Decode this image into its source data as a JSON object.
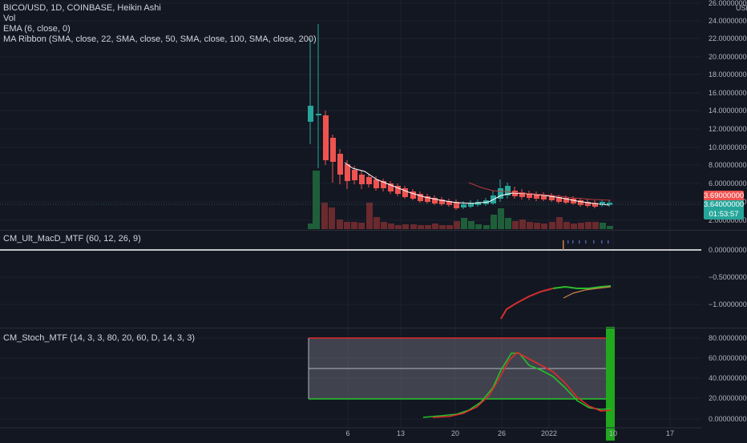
{
  "header": {
    "symbol_line": "BICO/USD, 1D, COINBASE, Heikin Ashi",
    "indicators": [
      "Vol",
      "EMA (6, close, 0)",
      "MA Ribbon (SMA, close, 22, SMA, close, 50, SMA, close, 100, SMA, close, 200)"
    ]
  },
  "price_axis": {
    "currency": "USD",
    "ticks": [
      "26.00000000",
      "24.00000000",
      "22.00000000",
      "20.00000000",
      "18.00000000",
      "16.00000000",
      "14.00000000",
      "12.00000000",
      "10.00000000",
      "8.00000000",
      "6.00000000",
      "4.00000000",
      "2.00000000"
    ],
    "tag_red": "3.69000000",
    "tag_green_price": "3.64000000",
    "tag_green_countdown": "01:53:57"
  },
  "macd_pane": {
    "label": "CM_Ult_MacD_MTF (60, 12, 26, 9)",
    "ticks": [
      "0.00000000",
      "−0.50000000",
      "−1.00000000"
    ]
  },
  "stoch_pane": {
    "label": "CM_Stoch_MTF (14, 3, 3, 80, 20, 60, D, 14, 3, 3)",
    "ticks": [
      "80.00000000",
      "60.00000000",
      "40.00000000",
      "20.00000000",
      "0.00000000"
    ]
  },
  "time_axis": {
    "labels": [
      "6",
      "13",
      "20",
      "26",
      "2022",
      "10",
      "17"
    ]
  },
  "colors": {
    "background": "#131722",
    "bull": "#26a69a",
    "bear": "#ef5350",
    "ema": "#ffffff",
    "stoch_green": "#26c22a",
    "stoch_red": "#e02b2b",
    "grid": "#1e222d"
  }
}
